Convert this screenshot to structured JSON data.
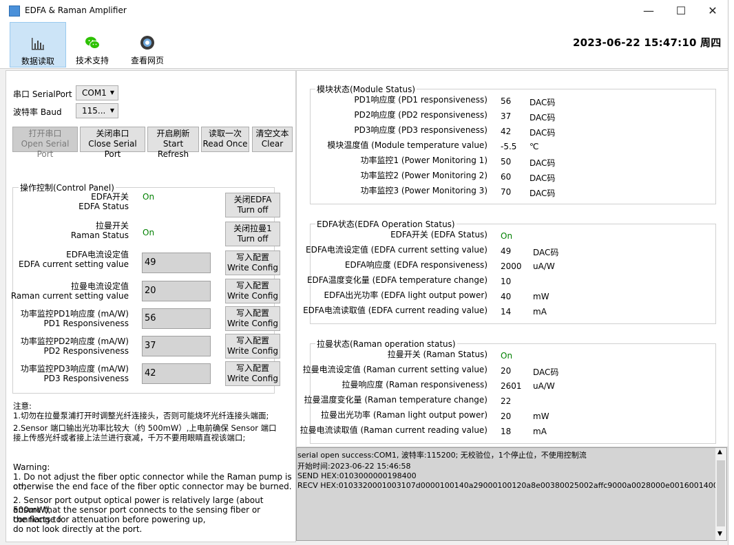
{
  "window": {
    "title": "EDFA & Raman Amplifier",
    "controls": [
      "—",
      "☐",
      "✕"
    ]
  },
  "toolbar": {
    "buttons": [
      {
        "label": "数据读取",
        "icon": "chart-icon",
        "active": true
      },
      {
        "label": "技术支持",
        "icon": "wechat-icon",
        "active": false
      },
      {
        "label": "查看网页",
        "icon": "web-icon",
        "active": false
      }
    ],
    "datetime": "2023-06-22 15:47:10 周四"
  },
  "serial": {
    "port_label": "串口 SerialPort",
    "port_value": "COM1",
    "baud_label": "波特率 Baud",
    "baud_value": "115...",
    "buttons": [
      {
        "cn": "打开串口",
        "en": "Open Serial Port",
        "disabled": true
      },
      {
        "cn": "关闭串口",
        "en": "Close Serial Port",
        "disabled": false
      },
      {
        "cn": "开启刷新",
        "en": "Start Refresh",
        "disabled": false
      },
      {
        "cn": "读取一次",
        "en": "Read Once",
        "disabled": false
      },
      {
        "cn": "清空文本",
        "en": "Clear",
        "disabled": false
      }
    ]
  },
  "control_panel": {
    "title": "操作控制(Control Panel)",
    "edfa_switch": {
      "cn": "EDFA开关",
      "en": "EDFA Status",
      "value": "On",
      "btn_cn": "关闭EDFA",
      "btn_en": "Turn off"
    },
    "raman_switch": {
      "cn": "拉曼开关",
      "en": "Raman Status",
      "value": "On",
      "btn_cn": "关闭拉曼1",
      "btn_en": "Turn off"
    },
    "fields": [
      {
        "cn": "EDFA电流设定值",
        "en": "EDFA current setting value",
        "value": "49"
      },
      {
        "cn": "拉曼电流设定值",
        "en": "Raman current setting value",
        "value": "20"
      },
      {
        "cn": "功率监控PD1响应度 (mA/W)",
        "en": "PD1 Responsiveness",
        "value": "56"
      },
      {
        "cn": "功率监控PD2响应度 (mA/W)",
        "en": "PD2 Responsiveness",
        "value": "37"
      },
      {
        "cn": "功率监控PD3响应度 (mA/W)",
        "en": "PD3 Responsiveness",
        "value": "42"
      }
    ],
    "write_btn_cn": "写入配置",
    "write_btn_en": "Write Config"
  },
  "notes": {
    "cn_title": "注意:",
    "cn_1": "1.切勿在拉曼泵浦打开时调整光纤连接头，否则可能烧坏光纤连接头端面;",
    "cn_2a": "2.Sensor 端口输出光功率比较大（约 500mW）,上电前确保 Sensor 端口",
    "cn_2b": "接上传感光纤或者接上法兰进行衰减，千万不要用眼睛直视该端口;",
    "en_title": "Warning:",
    "en_1a": "1. Do not adjust the fiber optic connector while the Raman pump is on,",
    "en_1b": " otherwise the end face of the fiber optic connector may be burned.",
    "en_2a": "2. Sensor port output optical power is relatively large (about 500mW),",
    "en_2b": " ensure that the sensor port connects to the sensing fiber or connects to",
    "en_2c": " the flange for attenuation before powering up,",
    "en_2d": " do not look directly at the port."
  },
  "module_status": {
    "title": "模块状态(Module Status)",
    "rows": [
      {
        "label": "PD1响应度 (PD1 responsiveness)",
        "value": "56",
        "unit": "DAC码"
      },
      {
        "label": "PD2响应度 (PD2 responsiveness)",
        "value": "37",
        "unit": "DAC码"
      },
      {
        "label": "PD3响应度 (PD3 responsiveness)",
        "value": "42",
        "unit": "DAC码"
      },
      {
        "label": "模块温度值 (Module temperature value)",
        "value": "-5.5",
        "unit": "℃"
      },
      {
        "label": "功率监控1 (Power Monitoring 1)",
        "value": "50",
        "unit": "DAC码"
      },
      {
        "label": "功率监控2 (Power Monitoring 2)",
        "value": "60",
        "unit": "DAC码"
      },
      {
        "label": "功率监控3 (Power Monitoring 3)",
        "value": "70",
        "unit": "DAC码"
      }
    ]
  },
  "edfa_status": {
    "title": "EDFA状态(EDFA Operation Status)",
    "rows": [
      {
        "label": "EDFA开关 (EDFA Status)",
        "value": "On",
        "unit": ""
      },
      {
        "label": "EDFA电流设定值 (EDFA current setting value)",
        "value": "49",
        "unit": "DAC码"
      },
      {
        "label": "EDFA响应度 (EDFA responsiveness)",
        "value": "2000",
        "unit": "uA/W"
      },
      {
        "label": "EDFA温度变化量 (EDFA temperature change)",
        "value": "10",
        "unit": ""
      },
      {
        "label": "EDFA出光功率 (EDFA light output power)",
        "value": "40",
        "unit": "mW"
      },
      {
        "label": "EDFA电流读取值 (EDFA current reading value)",
        "value": "14",
        "unit": "mA"
      }
    ]
  },
  "raman_status": {
    "title": "拉曼状态(Raman operation status)",
    "rows": [
      {
        "label": "拉曼开关 (Raman Status)",
        "value": "On",
        "unit": ""
      },
      {
        "label": "拉曼电流设定值 (Raman current setting value)",
        "value": "20",
        "unit": "DAC码"
      },
      {
        "label": "拉曼响应度 (Raman responsiveness)",
        "value": "2601",
        "unit": "uA/W"
      },
      {
        "label": "拉曼温度变化量 (Raman temperature change)",
        "value": "22",
        "unit": ""
      },
      {
        "label": "拉曼出光功率 (Raman light output power)",
        "value": "20",
        "unit": "mW"
      },
      {
        "label": "拉曼电流读取值 (Raman current reading value)",
        "value": "18",
        "unit": "mA"
      }
    ]
  },
  "console": {
    "lines": [
      "serial open success:COM1, 波特率:115200; 无校验位，1个停止位，不使用控制流",
      "开始时间:2023-06-22 15:46:58",
      "SEND HEX:0103000000198400",
      "RECV HEX:0103320001003107d0000100140a29000100120a8e00380025002affc9000a0028000e00160014001"
    ]
  },
  "colors": {
    "on_text": "#008000",
    "active_tab": "#cce4f7",
    "console_bg": "#d4d4d4"
  }
}
